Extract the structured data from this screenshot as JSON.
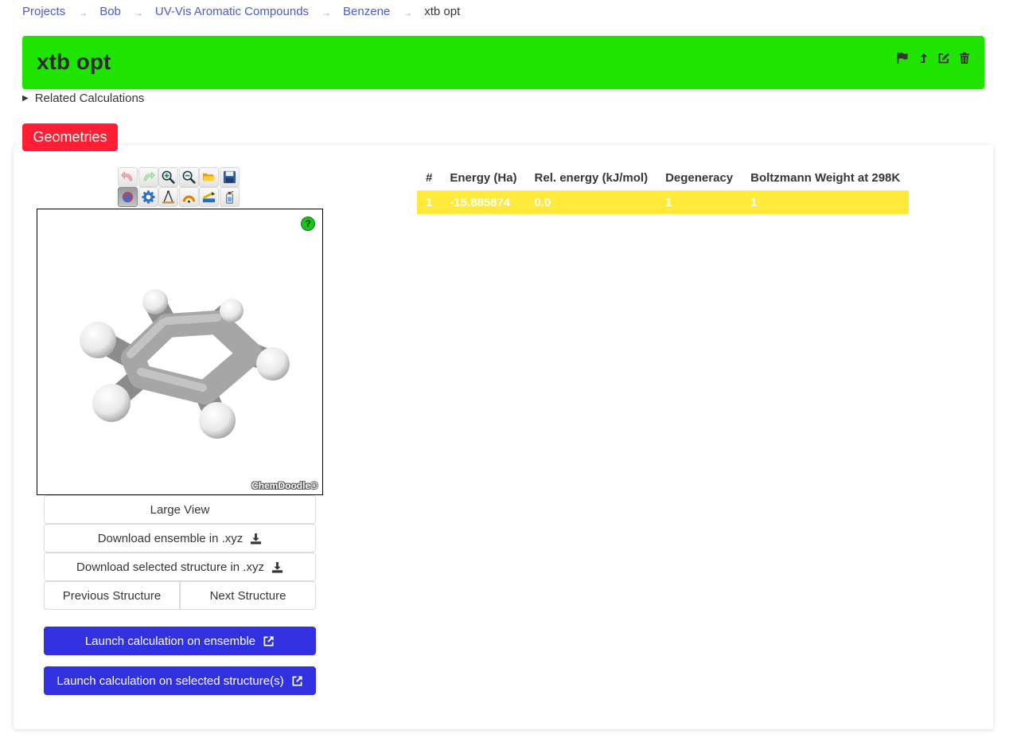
{
  "breadcrumb": {
    "items": [
      "Projects",
      "Bob",
      "UV-Vis Aromatic Compounds",
      "Benzene",
      "xtb opt"
    ],
    "separator": "→"
  },
  "header": {
    "title": "xtb opt",
    "bg_color": "#1ee400",
    "action_icons": [
      "flag-icon",
      "move-up-icon",
      "edit-icon",
      "trash-icon"
    ]
  },
  "related": {
    "label": "Related Calculations",
    "icon": "triangle-right-icon"
  },
  "geometries": {
    "tag_label": "Geometries",
    "tag_color": "#ff1f35"
  },
  "viewer": {
    "help_label": "?",
    "brand": "ChemDoodle®",
    "toolbar_icons": [
      [
        "undo-icon",
        "redo-icon",
        "zoom-in-icon",
        "zoom-out-icon",
        "open-icon",
        "save-icon"
      ],
      [
        "rotate-icon",
        "settings-icon",
        "distance-icon",
        "angle-icon",
        "torsion-icon",
        "clear-icon"
      ]
    ]
  },
  "buttons": {
    "large_view": "Large View",
    "download_ensemble": "Download ensemble in .xyz",
    "download_selected": "Download selected structure in .xyz",
    "previous": "Previous Structure",
    "next": "Next Structure",
    "launch_ensemble": "Launch calculation on ensemble",
    "launch_selected": "Launch calculation on selected structure(s)",
    "accent_color": "#3131e0"
  },
  "table": {
    "headers": [
      "#",
      "Energy (Ha)",
      "Rel. energy (kJ/mol)",
      "Degeneracy",
      "Boltzmann Weight at 298K"
    ],
    "rows": [
      {
        "index": "1",
        "energy": "-15.885874",
        "rel_energy": "0.0",
        "degeneracy": "1",
        "boltzmann": "1"
      }
    ],
    "selected_row_color": "#ffe93a"
  }
}
